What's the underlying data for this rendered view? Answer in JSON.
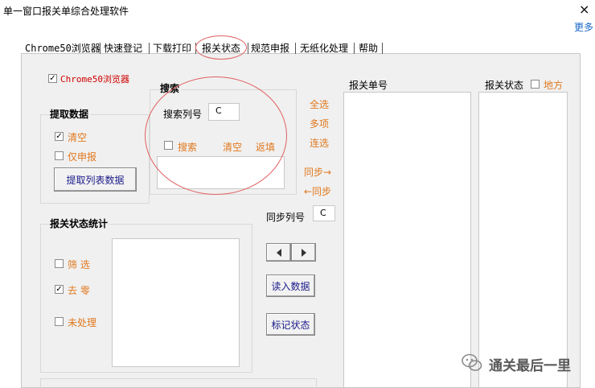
{
  "window": {
    "title": "单一窗口报关单综合处理软件",
    "close": "×",
    "more": "更多"
  },
  "tabs": [
    {
      "label": "Chrome50浏览器"
    },
    {
      "label": "快速登记"
    },
    {
      "label": "下载打印"
    },
    {
      "label": "报关状态"
    },
    {
      "label": "规范申报"
    },
    {
      "label": "无纸化处理"
    },
    {
      "label": "帮助"
    }
  ],
  "browser_check": {
    "label": "Chrome50浏览器",
    "checked": "✓"
  },
  "extract": {
    "title": "提取数据",
    "clear": {
      "label": "清空",
      "checked": "✓"
    },
    "only_declare": {
      "label": "仅申报",
      "checked": ""
    },
    "button": "提取列表数据"
  },
  "search": {
    "title": "搜索",
    "column_label": "搜索列号",
    "column_value": "C",
    "search_check": {
      "label": "搜索",
      "checked": ""
    },
    "clear": "清空",
    "backfill": "返填"
  },
  "selection": {
    "all": "全选",
    "multi": "多项",
    "continuous": "连选"
  },
  "sync": {
    "forward": "同步→",
    "backward": "←同步",
    "column_label": "同步列号",
    "column_value": "C"
  },
  "stats": {
    "title": "报关状态统计",
    "filter": {
      "label": "筛 选",
      "checked": ""
    },
    "dezero": {
      "label": "去 零",
      "checked": "✓"
    },
    "unprocessed": {
      "label": "未处理",
      "checked": ""
    }
  },
  "buttons": {
    "read_data": "读入数据",
    "mark_status": "标记状态"
  },
  "columns": {
    "decl_no": "报关单号",
    "decl_status": "报关状态",
    "local": {
      "label": "地方",
      "checked": ""
    }
  },
  "watermark": {
    "text": "通关最后一里"
  }
}
